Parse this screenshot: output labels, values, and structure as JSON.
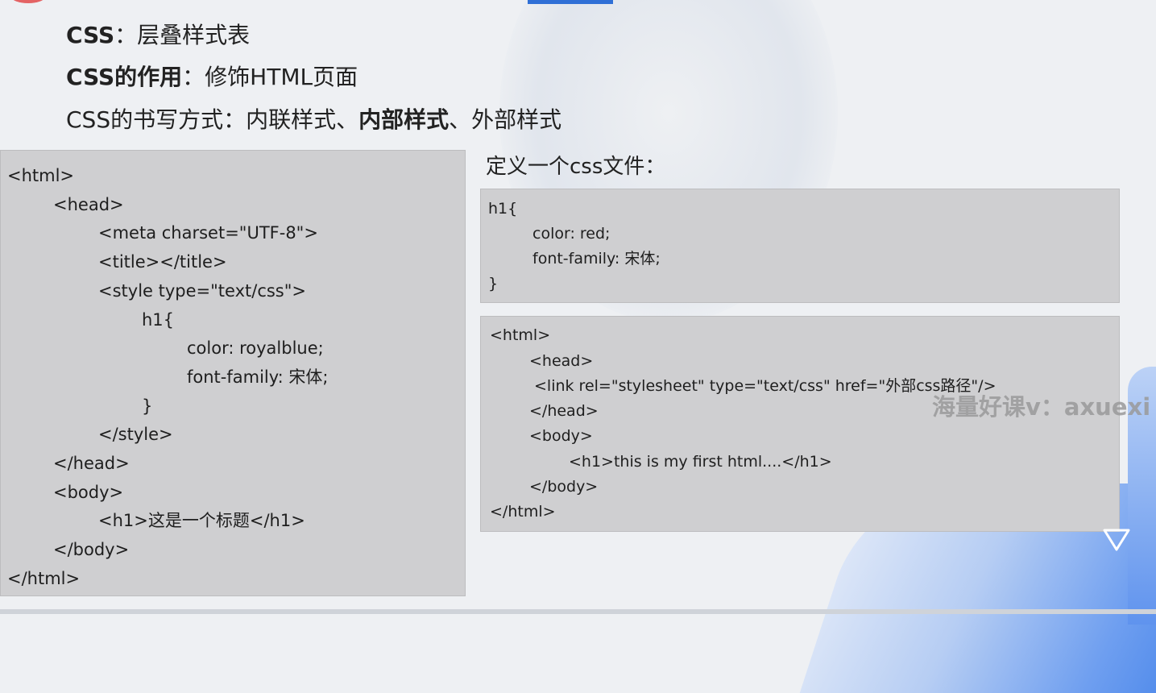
{
  "header": {
    "line1": {
      "bold": "CSS",
      "rest": "：层叠样式表"
    },
    "line2": {
      "bold": "CSS的作用",
      "rest": "：修饰HTML页面"
    },
    "line3": {
      "prefix": "CSS的书写方式：内联样式、",
      "bold": "内部样式",
      "suffix": "、外部样式"
    }
  },
  "left_code": {
    "lines": [
      "<html>",
      "<head>",
      "<meta charset=\"UTF-8\">",
      "<title></title>",
      "<style type=\"text/css\">",
      "h1{",
      "color: royalblue;",
      "font-family: 宋体;",
      "}",
      "</style>",
      "</head>",
      "<body>",
      "<h1>这是一个标题</h1>",
      "</body>",
      "</html>"
    ]
  },
  "css_file": {
    "title": "定义一个css文件：",
    "lines": [
      "h1{",
      "color: red;",
      "font-family: 宋体;",
      "}"
    ]
  },
  "link_code": {
    "lines": [
      "<html>",
      "<head>",
      "<link rel=\"stylesheet\" type=\"text/css\" href=\"外部css路径\"/>",
      "</head>",
      "<body>",
      "<h1>this is my first html....</h1>",
      "</body>",
      "</html>"
    ]
  },
  "watermark": "海量好课v：axuexi",
  "colors": {
    "accent_blue": "#2f6fd6",
    "code_bg": "#cfcfd1"
  }
}
